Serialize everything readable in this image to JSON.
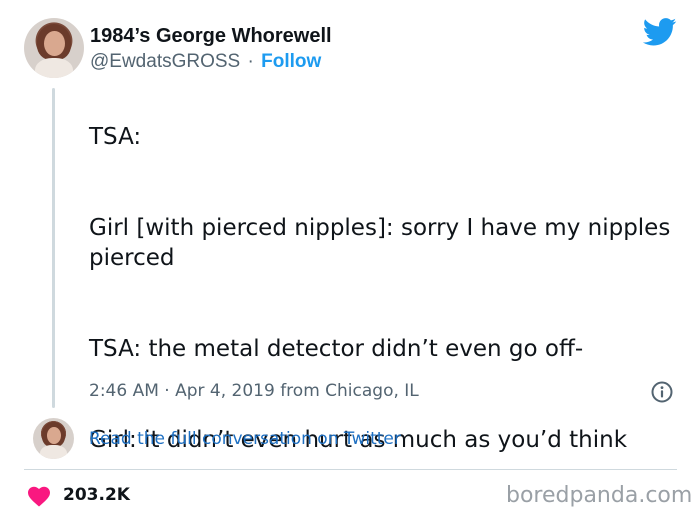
{
  "author": {
    "display_name": "1984’s George Whorewell",
    "handle": "@EwdatsGROSS",
    "separator": "·",
    "follow_label": "Follow"
  },
  "tweet": {
    "paragraphs": [
      "TSA:",
      "Girl [with pierced nipples]: sorry I have my nipples pierced",
      "TSA: the metal detector didn’t even go off-",
      "Girl: it didn’t even hurt as much as you’d think"
    ],
    "timestamp": "2:46 AM · Apr 4, 2019 from Chicago, IL"
  },
  "conversation_link": "Read the full conversation on Twitter",
  "engagement": {
    "likes": "203.2K"
  },
  "watermark": "boredpanda.com",
  "colors": {
    "accent": "#1d9bf0",
    "link": "#1d6fc2",
    "heart": "#f91880",
    "muted": "#536471"
  },
  "icons": {
    "brand": "twitter-bird-icon",
    "info": "info-icon",
    "like": "heart-icon"
  }
}
